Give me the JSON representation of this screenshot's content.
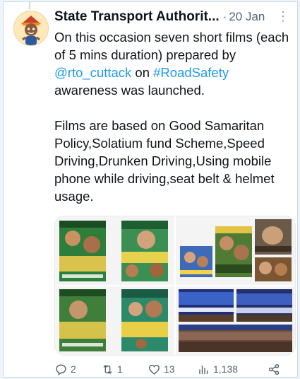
{
  "tweet": {
    "author": "State Transport Authorit...",
    "separator": "·",
    "date": "20 Jan",
    "more_glyph": "⋮",
    "text_line1": "On this occasion seven short films (each of  5 mins duration) prepared by ",
    "mention": "@rto_cuttack",
    "text_on": " on ",
    "hashtag": "#RoadSafety",
    "text_after": " awareness was launched.",
    "paragraph2": "Films are based on Good Samaritan Policy,Solatium fund Scheme,Speed Driving,Drunken Driving,Using mobile phone while driving,seat belt & helmet usage."
  },
  "actions": {
    "replies": "2",
    "reposts": "1",
    "likes": "13",
    "views": "1,138"
  },
  "colors": {
    "link": "#1d9bf0",
    "muted": "#536471",
    "border": "#cfd9de"
  },
  "icons": {
    "reply": "reply-icon",
    "repost": "repost-icon",
    "like": "heart-icon",
    "views": "views-icon",
    "share": "share-icon"
  }
}
